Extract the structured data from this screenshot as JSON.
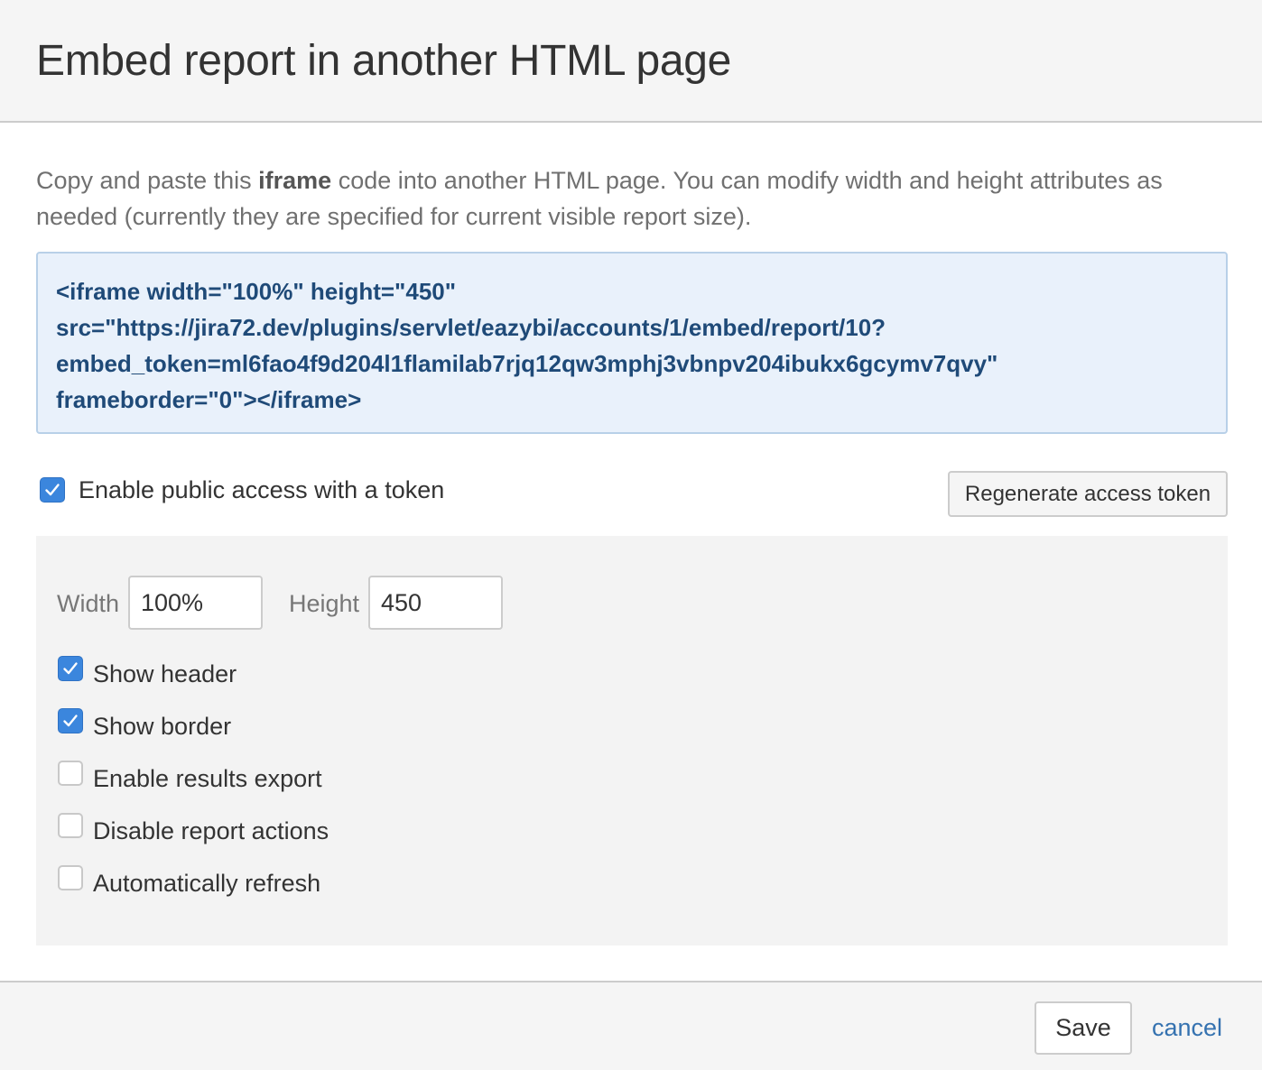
{
  "dialog": {
    "title": "Embed report in another HTML page"
  },
  "intro": {
    "prefix": "Copy and paste this ",
    "bold": "iframe",
    "suffix": " code into another HTML page. You can modify width and height attributes as needed (currently they are specified for current visible report size)."
  },
  "embed_code": {
    "line1": "<iframe width=\"100%\" height=\"450\"",
    "line2": "src=\"https://jira72.dev/plugins/servlet/eazybi/accounts/1/embed/report/10?",
    "line3": "embed_token=ml6fao4f9d204l1flamilab7rjq12qw3mphj3vbnpv204ibukx6gcymv7qvy\"",
    "line4": "frameborder=\"0\"></iframe>"
  },
  "public_access": {
    "label": "Enable public access with a token",
    "checked": true,
    "regenerate_label": "Regenerate access token"
  },
  "options": {
    "width_label": "Width",
    "width_value": "100%",
    "height_label": "Height",
    "height_value": "450",
    "show_header": {
      "label": "Show header",
      "checked": true
    },
    "show_border": {
      "label": "Show border",
      "checked": true
    },
    "enable_export": {
      "label": "Enable results export",
      "checked": false
    },
    "disable_actions": {
      "label": "Disable report actions",
      "checked": false
    },
    "auto_refresh": {
      "label": "Automatically refresh",
      "checked": false
    }
  },
  "footer": {
    "save_label": "Save",
    "cancel_label": "cancel"
  },
  "colors": {
    "accent": "#3b86dd",
    "link": "#3572b0",
    "code_text": "#1f4a78",
    "code_bg": "#e9f1fb"
  }
}
